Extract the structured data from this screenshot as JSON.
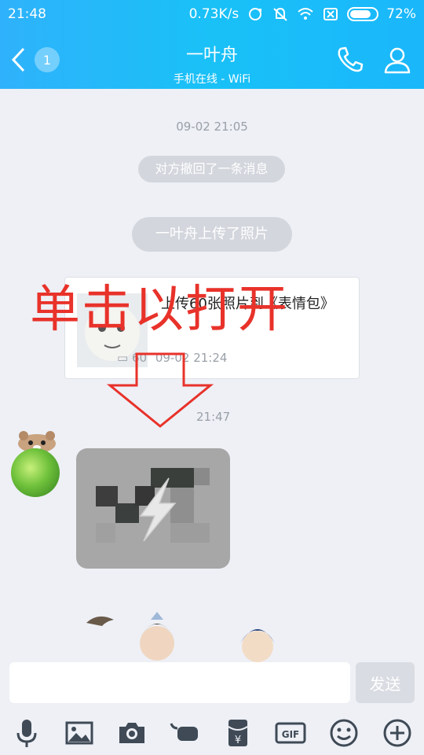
{
  "status_bar": {
    "time": "21:48",
    "net_speed": "0.73K/s",
    "battery": "72%"
  },
  "header": {
    "back_count": "1",
    "title": "一叶舟",
    "subtitle": "手机在线 - WiFi"
  },
  "chat": {
    "ts1": "09-02 21:05",
    "recall_notice": "对方撤回了一条消息",
    "upload_notice": "一叶舟上传了照片",
    "card": {
      "text": "上传60张照片到《表情包》",
      "count": "60",
      "time": "09-02 21:24"
    },
    "overlay_text": "单击以打开",
    "ts2": "21:47"
  },
  "input": {
    "value": "",
    "send_label": "发送"
  },
  "toolbar": [
    "microphone-icon",
    "image-icon",
    "camera-icon",
    "poke-icon",
    "redpacket-icon",
    "gif-icon",
    "emoji-icon",
    "plus-icon"
  ]
}
